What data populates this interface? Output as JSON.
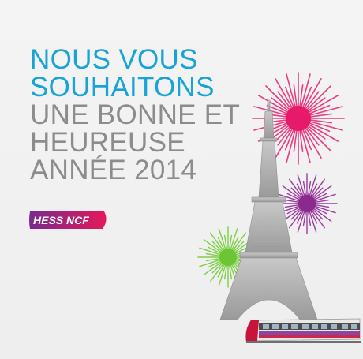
{
  "headline": {
    "line1": "NOUS VOUS",
    "line2": "SOUHAITONS",
    "line3": "UNE BONNE ET",
    "line4": "HEUREUSE",
    "line5": "ANNÉE 2014"
  },
  "logo": {
    "text": "HESS NCF"
  },
  "colors": {
    "headline_blue": "#1aa4d6",
    "headline_grey": "#8c8c8c",
    "firework_pink": "#e6196b",
    "firework_purple": "#8a2a8c",
    "firework_green": "#6cc534",
    "logo_gradient_start": "#7a2a8f",
    "logo_gradient_end": "#e3195a"
  },
  "icons": [
    "eiffel-tower-icon",
    "firework-icon",
    "train-icon"
  ]
}
